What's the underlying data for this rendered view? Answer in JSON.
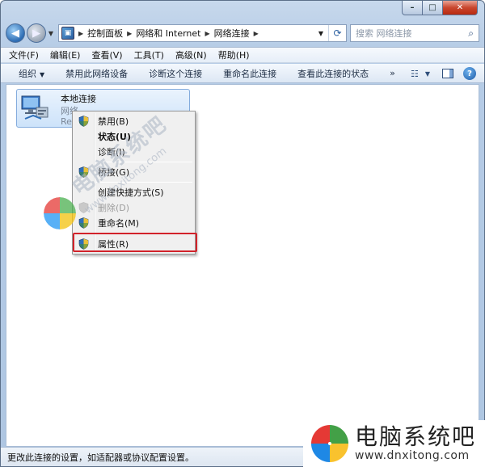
{
  "window": {
    "caption": {
      "minimize": "–",
      "maximize": "□",
      "close": "✕"
    }
  },
  "address": {
    "crumbs": [
      "控制面板",
      "网络和 Internet",
      "网络连接"
    ],
    "search_placeholder": "搜索 网络连接"
  },
  "menubar": {
    "items": [
      "文件(F)",
      "编辑(E)",
      "查看(V)",
      "工具(T)",
      "高级(N)",
      "帮助(H)"
    ]
  },
  "commandbar": {
    "organize": "组织",
    "disable": "禁用此网络设备",
    "diagnose": "诊断这个连接",
    "rename": "重命名此连接",
    "status": "查看此连接的状态",
    "more": "»"
  },
  "connection": {
    "name": "本地连接",
    "line1": "网络",
    "line2": "Real"
  },
  "context_menu": {
    "items": [
      {
        "label": "禁用(B)",
        "shield": true,
        "bold": false,
        "disabled": false
      },
      {
        "label": "状态(U)",
        "shield": false,
        "bold": true,
        "disabled": false
      },
      {
        "label": "诊断(I)",
        "shield": false,
        "bold": false,
        "disabled": false
      },
      {
        "label": "桥接(G)",
        "shield": true,
        "bold": false,
        "disabled": false
      },
      {
        "label": "创建快捷方式(S)",
        "shield": false,
        "bold": false,
        "disabled": false
      },
      {
        "label": "删除(D)",
        "shield": true,
        "bold": false,
        "disabled": true
      },
      {
        "label": "重命名(M)",
        "shield": true,
        "bold": false,
        "disabled": false
      },
      {
        "label": "属性(R)",
        "shield": true,
        "bold": false,
        "disabled": false
      }
    ]
  },
  "watermark": {
    "text": "电脑系统吧",
    "url": "www.dnxitong.com"
  },
  "brand": {
    "name": "电脑系统吧",
    "url": "www.dnxitong.com"
  },
  "statusbar": {
    "text": "更改此连接的设置，如适配器或协议配置设置。"
  },
  "colors": {
    "highlight_box": "#d2222a",
    "selection_bg": "#cde3fa"
  }
}
